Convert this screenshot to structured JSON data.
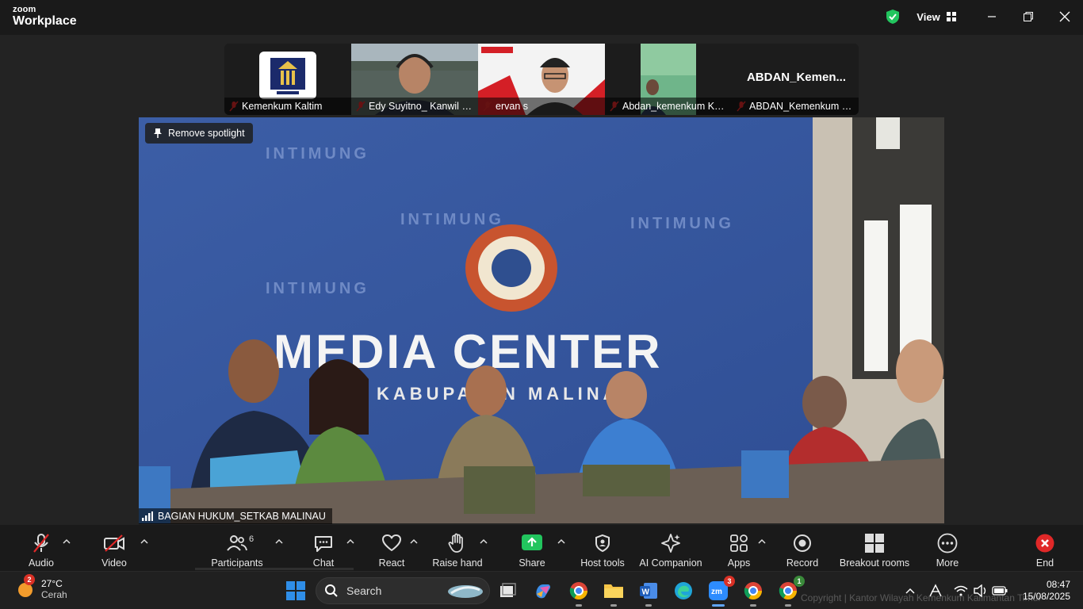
{
  "app": {
    "brand_top": "zoom",
    "brand_bottom": "Workplace",
    "view_label": "View"
  },
  "participants": [
    {
      "name": "Kemenkum Kaltim",
      "muted": true,
      "type": "logo"
    },
    {
      "name": "Edy Suyitno_ Kanwil K...",
      "muted": true,
      "type": "video"
    },
    {
      "name": "ervan s",
      "muted": true,
      "type": "video"
    },
    {
      "name": "Abdan_kemenkum Ka...",
      "muted": true,
      "type": "video"
    },
    {
      "name": "ABDAN_Kemenkum K...",
      "muted": true,
      "type": "text",
      "big_label": "ABDAN_Kemen..."
    }
  ],
  "main_video": {
    "spotlight_button": "Remove spotlight",
    "speaker_name": "BAGIAN HUKUM_SETKAB MALINAU",
    "backdrop_text": "MEDIA CENTER",
    "backdrop_subtext": "KABUPATEN MALINAU",
    "backdrop_pattern": "INTIMUNG"
  },
  "toolbar": {
    "audio": "Audio",
    "video": "Video",
    "participants": "Participants",
    "participants_count": "6",
    "chat": "Chat",
    "react": "React",
    "raise_hand": "Raise hand",
    "share": "Share",
    "host_tools": "Host tools",
    "ai_companion": "AI Companion",
    "apps": "Apps",
    "record": "Record",
    "breakout": "Breakout rooms",
    "more": "More",
    "end": "End"
  },
  "taskbar": {
    "weather_temp": "27°C",
    "weather_desc": "Cerah",
    "weather_badge": "2",
    "search_placeholder": "Search",
    "zoom_badge": "3",
    "chrome_badge": "1",
    "time": "08:47",
    "date": "15/08/2025",
    "watermark": "Copyright | Kantor Wilayah Kemenkum Kalimantan Timur"
  },
  "colors": {
    "accent_green": "#22c55e",
    "end_red": "#e02828",
    "mute_red": "#e02828",
    "backdrop_blue": "#3a5ea8"
  }
}
